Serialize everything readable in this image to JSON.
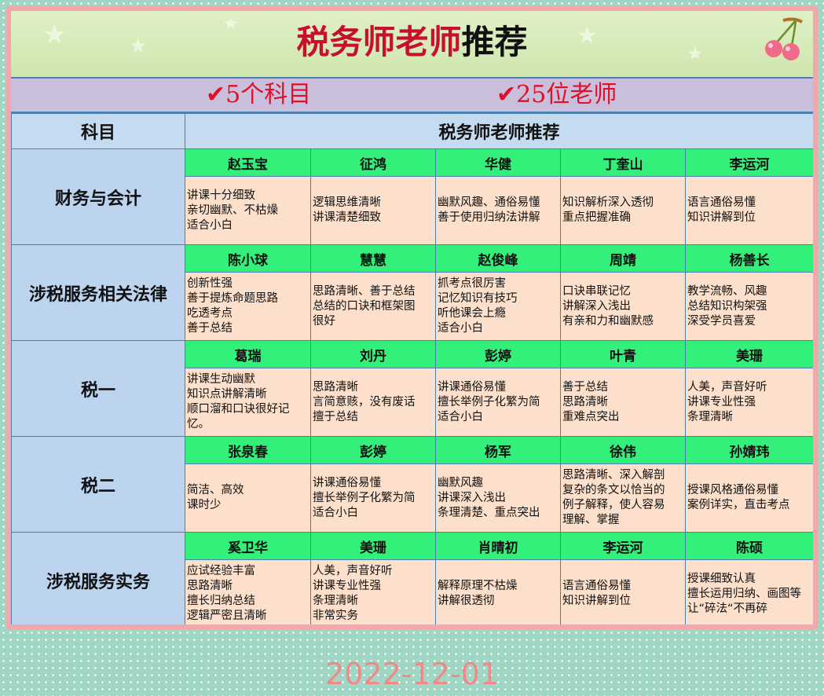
{
  "title": {
    "red": "税务师老师",
    "black": "推荐"
  },
  "subheader": {
    "check_symbol": "✔",
    "item1": "5个科目",
    "item2": "25位老师"
  },
  "table": {
    "col1_header": "科目",
    "col2_header": "税务师老师推荐",
    "rows": [
      {
        "subject": "财务与会计",
        "teachers": [
          {
            "name": "赵玉宝",
            "desc": "讲课十分细致\n亲切幽默、不枯燥\n适合小白"
          },
          {
            "name": "征鸿",
            "desc": "逻辑思维清晰\n讲课清楚细致"
          },
          {
            "name": "华健",
            "desc": "幽默风趣、通俗易懂\n善于使用归纳法讲解"
          },
          {
            "name": "丁奎山",
            "desc": "知识解析深入透彻\n重点把握准确"
          },
          {
            "name": "李运河",
            "desc": "语言通俗易懂\n知识讲解到位"
          }
        ]
      },
      {
        "subject": "涉税服务相关法律",
        "teachers": [
          {
            "name": "陈小球",
            "desc": "创新性强\n善于提炼命题思路\n吃透考点\n善于总结"
          },
          {
            "name": "慧慧",
            "desc": "思路清晰、善于总结\n总结的口诀和框架图\n很好"
          },
          {
            "name": "赵俊峰",
            "desc": "抓考点很厉害\n记忆知识有技巧\n听他课会上瘾\n适合小白"
          },
          {
            "name": "周靖",
            "desc": "口诀串联记忆\n讲解深入浅出\n有亲和力和幽默感"
          },
          {
            "name": "杨善长",
            "desc": "教学流畅、风趣\n总结知识构架强\n深受学员喜爱"
          }
        ]
      },
      {
        "subject": "税一",
        "teachers": [
          {
            "name": "葛瑞",
            "desc": "讲课生动幽默\n知识点讲解清晰\n顺口溜和口诀很好记\n忆。"
          },
          {
            "name": "刘丹",
            "desc": "思路清晰\n言简意赅，没有废话\n擅于总结"
          },
          {
            "name": "彭婷",
            "desc": "讲课通俗易懂\n擅长举例子化繁为简\n适合小白"
          },
          {
            "name": "叶青",
            "desc": "善于总结\n思路清晰\n重难点突出"
          },
          {
            "name": "美珊",
            "desc": "人美，声音好听\n讲课专业性强\n条理清晰"
          }
        ]
      },
      {
        "subject": "税二",
        "teachers": [
          {
            "name": "张泉春",
            "desc": "简洁、高效\n课时少"
          },
          {
            "name": "彭婷",
            "desc": "讲课通俗易懂\n擅长举例子化繁为简\n适合小白"
          },
          {
            "name": "杨军",
            "desc": "幽默风趣\n讲课深入浅出\n条理清楚、重点突出"
          },
          {
            "name": "徐伟",
            "desc": "思路清晰、深入解剖\n复杂的条文以恰当的\n例子解释，使人容易\n理解、掌握"
          },
          {
            "name": "孙婧玮",
            "desc": "授课风格通俗易懂\n案例详实，直击考点"
          }
        ]
      },
      {
        "subject": "涉税服务实务",
        "teachers": [
          {
            "name": "奚卫华",
            "desc": "应试经验丰富\n思路清晰\n擅长归纳总结\n逻辑严密且清晰"
          },
          {
            "name": "美珊",
            "desc": "人美，声音好听\n讲课专业性强\n条理清晰\n非常实务"
          },
          {
            "name": "肖晴初",
            "desc": "解释原理不枯燥\n讲解很透彻"
          },
          {
            "name": "李运河",
            "desc": "语言通俗易懂\n知识讲解到位"
          },
          {
            "name": "陈硕",
            "desc": "授课细致认真\n擅长运用归纳、画图等\n让“碎法“不再碎"
          }
        ]
      }
    ]
  },
  "date": "2022-12-01",
  "colors": {
    "title_red": "#c8102e",
    "check_red": "#e0102a",
    "name_green": "#33f07a",
    "desc_peach": "#fde0cc",
    "subject_blue": "#bcd4ee",
    "frame_pink": "#f3a6ac",
    "date_pink": "#f08a8a"
  },
  "icons": [
    "cherry-icon",
    "check-icon"
  ]
}
